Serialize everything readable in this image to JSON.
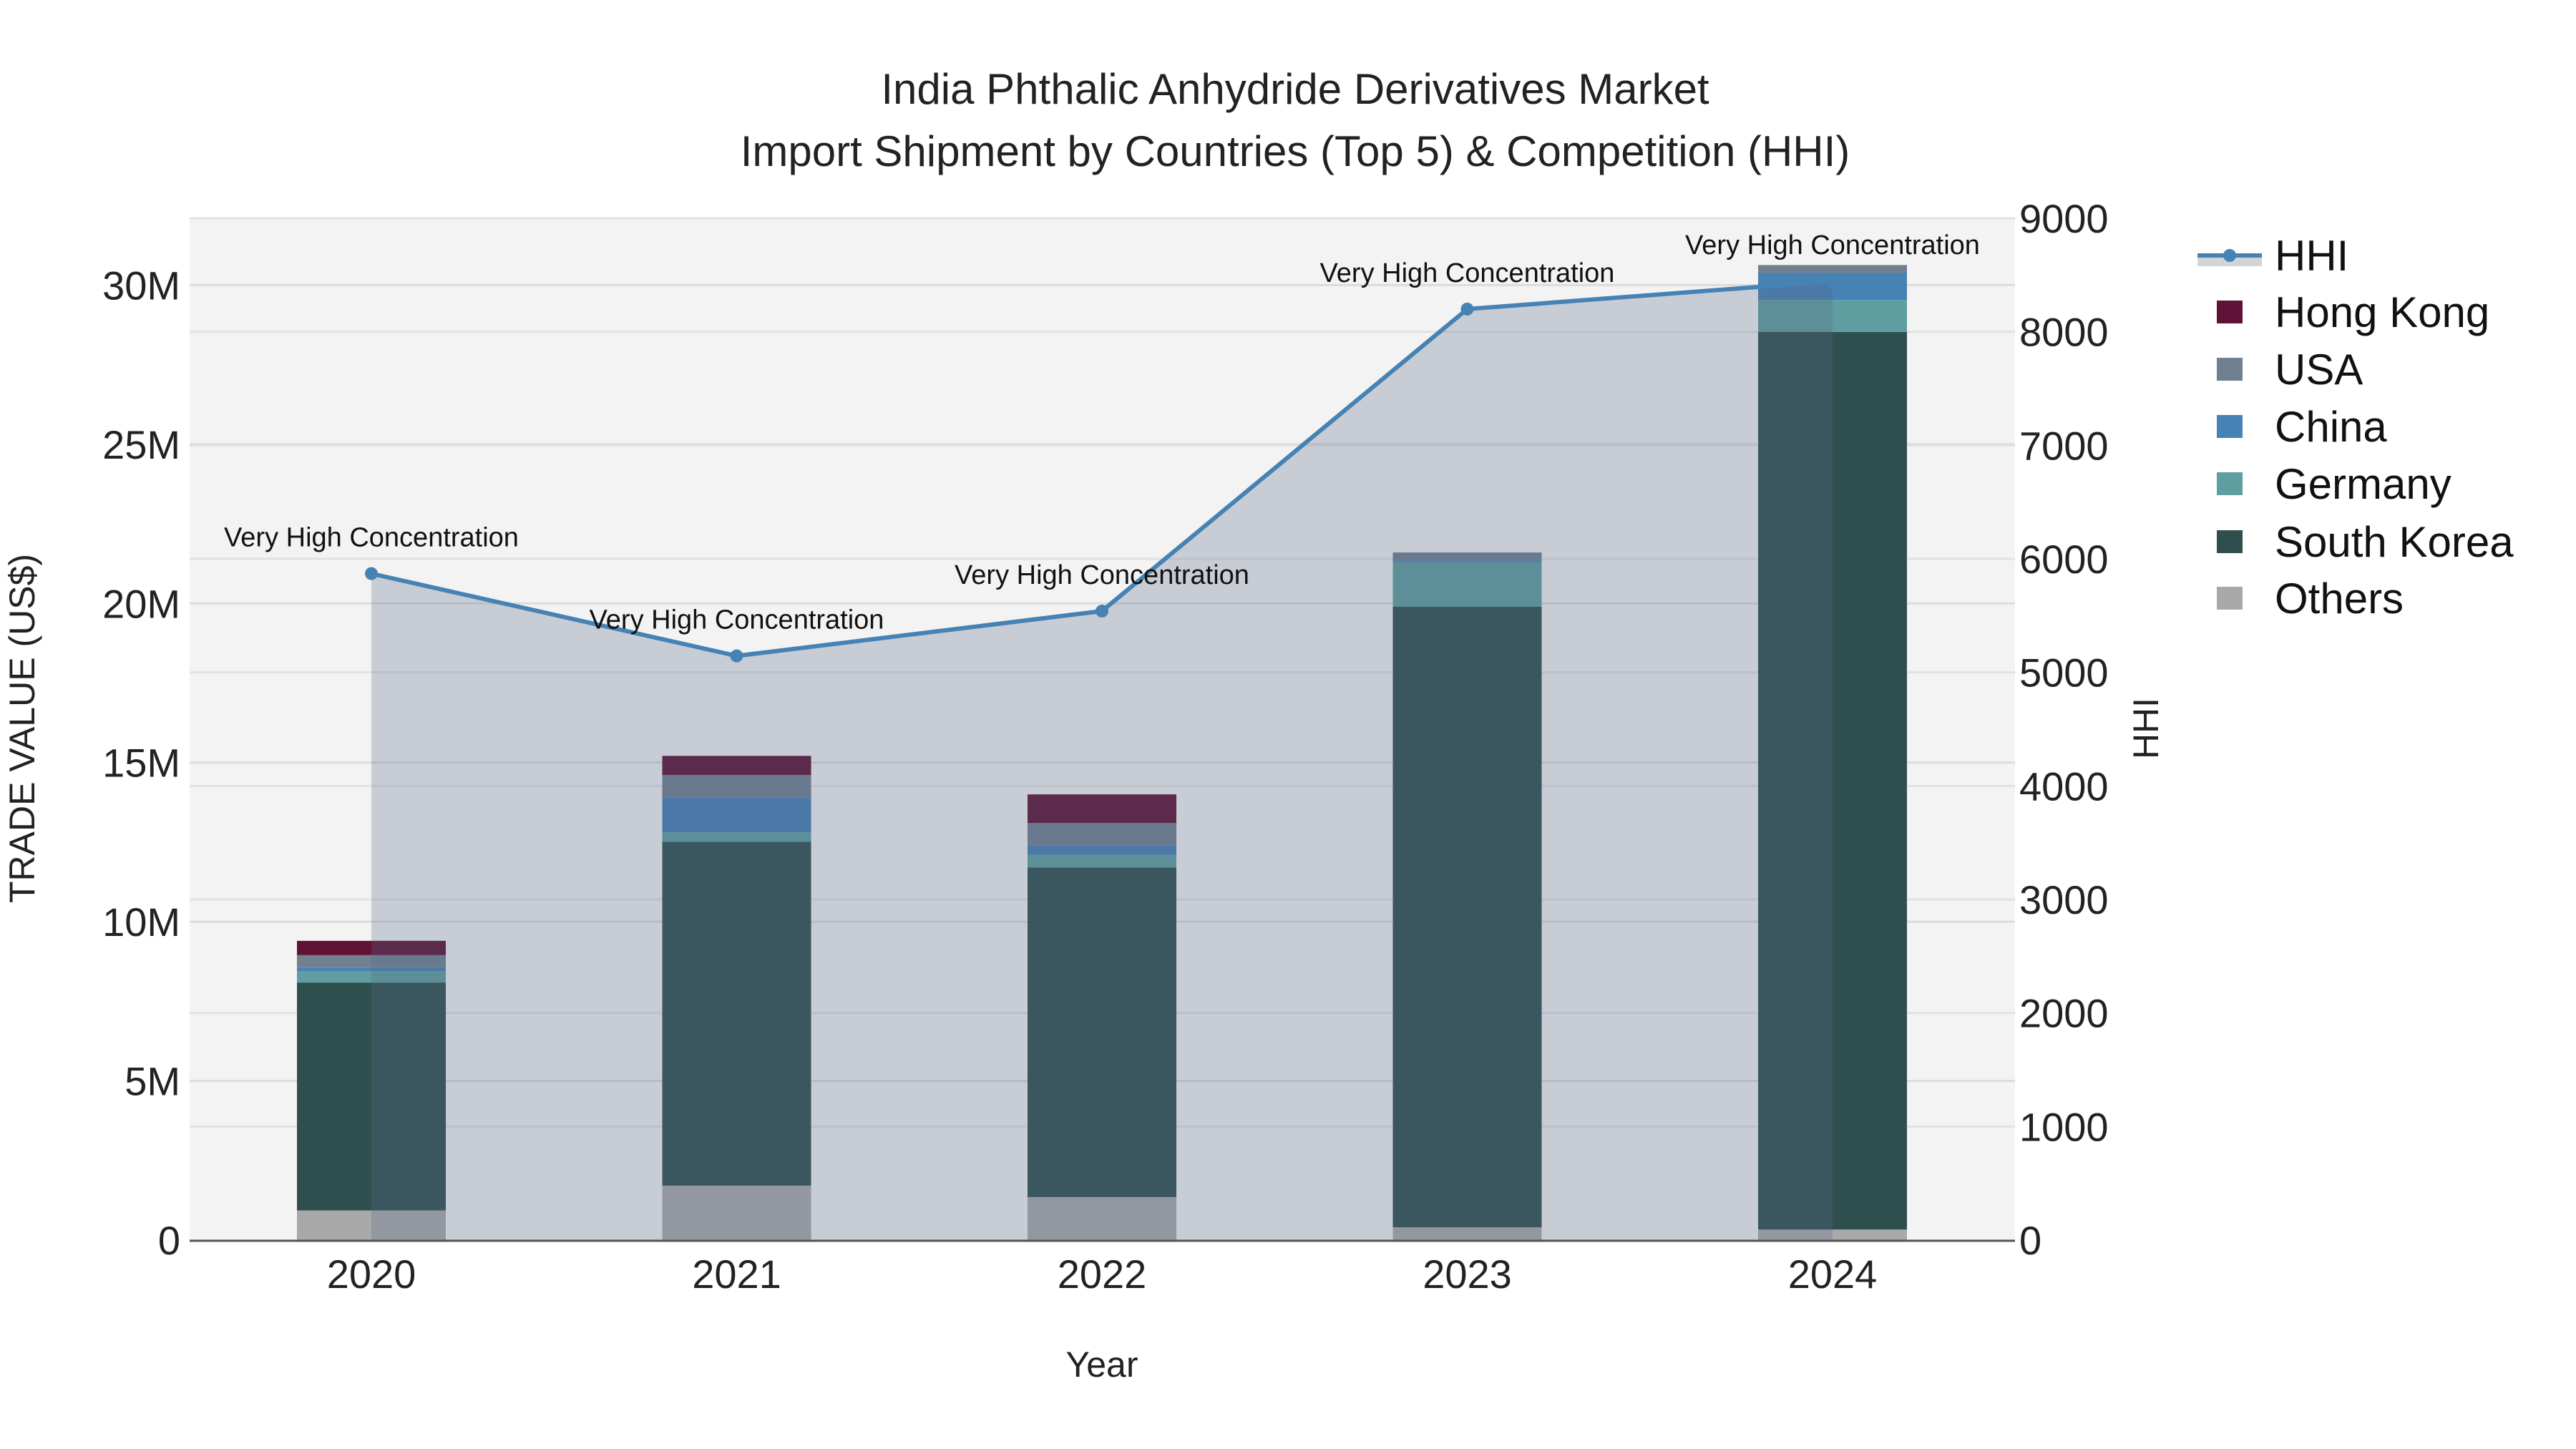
{
  "chart_data": {
    "type": "bar",
    "title": "India Phthalic Anhydride Derivatives Market",
    "subtitle": "Import Shipment by Countries (Top 5) & Competition (HHI)",
    "xlabel": "Year",
    "ylabel": "TRADE VALUE (US$)",
    "y2label": "HHI",
    "categories": [
      "2020",
      "2021",
      "2022",
      "2023",
      "2024"
    ],
    "ylim": [
      0,
      32100000
    ],
    "y2lim": [
      0,
      9000
    ],
    "yticks": [
      {
        "v": 0,
        "label": "0"
      },
      {
        "v": 5000000,
        "label": "5M"
      },
      {
        "v": 10000000,
        "label": "10M"
      },
      {
        "v": 15000000,
        "label": "15M"
      },
      {
        "v": 20000000,
        "label": "20M"
      },
      {
        "v": 25000000,
        "label": "25M"
      },
      {
        "v": 30000000,
        "label": "30M"
      }
    ],
    "y2ticks": [
      "0",
      "1000",
      "2000",
      "3000",
      "4000",
      "5000",
      "6000",
      "7000",
      "8000",
      "9000"
    ],
    "stack_order": [
      "Others",
      "South Korea",
      "Germany",
      "China",
      "USA",
      "Hong Kong"
    ],
    "series": [
      {
        "name": "Hong Kong",
        "color": "#5e1336",
        "values": [
          450000,
          600000,
          900000,
          0,
          0
        ]
      },
      {
        "name": "USA",
        "color": "#708090",
        "values": [
          400000,
          700000,
          700000,
          250000,
          250000
        ]
      },
      {
        "name": "China",
        "color": "#4682b4",
        "values": [
          100000,
          1100000,
          300000,
          50000,
          850000
        ]
      },
      {
        "name": "Germany",
        "color": "#5f9ea0",
        "values": [
          360000,
          300000,
          400000,
          1400000,
          1000000
        ]
      },
      {
        "name": "South Korea",
        "color": "#2f4f4f",
        "values": [
          7160000,
          10800000,
          10350000,
          19500000,
          28200000
        ]
      },
      {
        "name": "Others",
        "color": "#a9a9a9",
        "values": [
          930000,
          1710000,
          1350000,
          400000,
          330000
        ]
      }
    ],
    "line": {
      "name": "HHI",
      "color": "#4682b4",
      "axis": "right",
      "values": [
        5870,
        5145,
        5540,
        8200,
        8445
      ],
      "annotations": [
        "Very High Concentration",
        "Very High Concentration",
        "Very High Concentration",
        "Very High Concentration",
        "Very High Concentration"
      ]
    },
    "legend": [
      "HHI",
      "Hong Kong",
      "USA",
      "China",
      "Germany",
      "South Korea",
      "Others"
    ],
    "legend_position": "right",
    "grid": true
  }
}
